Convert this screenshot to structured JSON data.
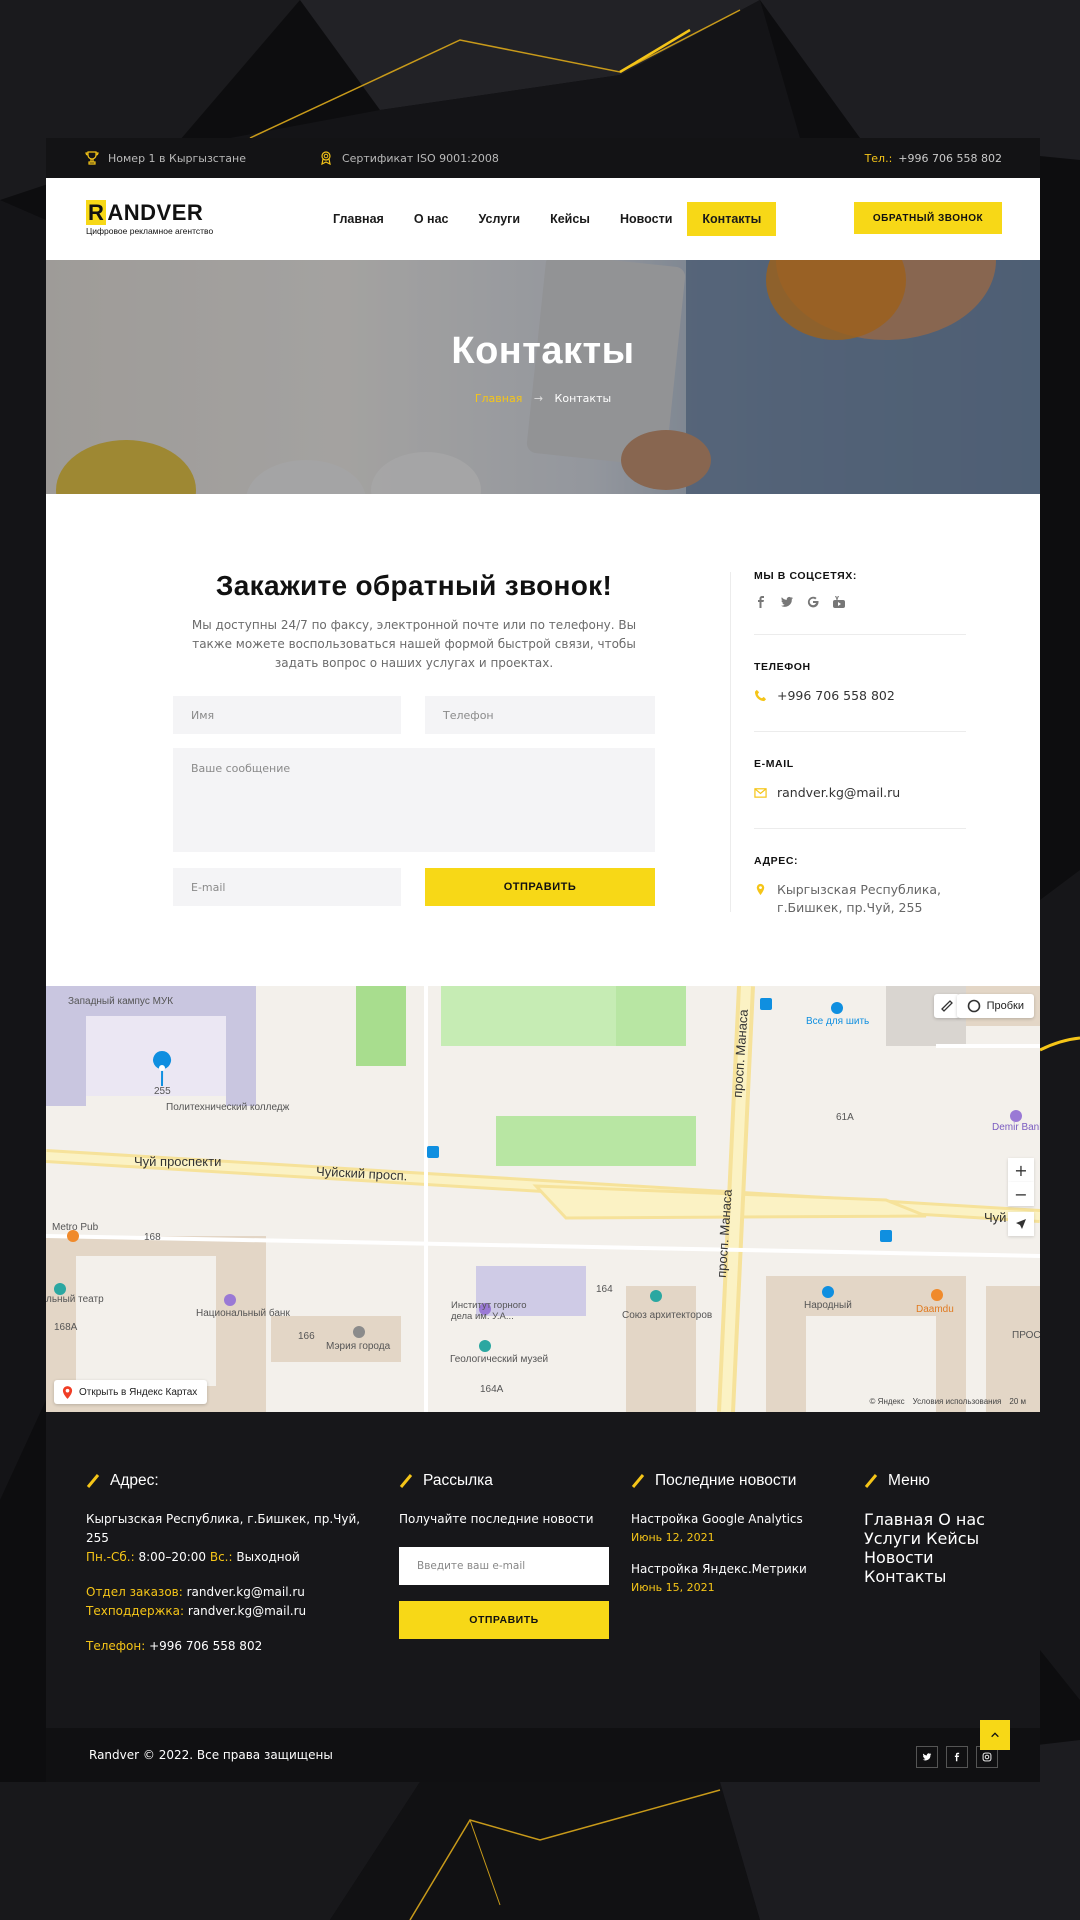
{
  "topbar": {
    "rank_text": "Номер 1 в Кыргызстане",
    "cert_text": "Сертификат ISO 9001:2008",
    "phone_label": "Тел.:",
    "phone_value": "+996 706 558 802"
  },
  "header": {
    "logo_r": "R",
    "logo_rest": "ANDVER",
    "logo_tagline": "Цифровое рекламное агентство",
    "nav": [
      "Главная",
      "О нас",
      "Услуги",
      "Кейсы",
      "Новости",
      "Контакты"
    ],
    "active_nav": "Контакты",
    "callback_button": "ОБРАТНЫЙ ЗВОНОК"
  },
  "hero": {
    "title": "Контакты",
    "crumb_home": "Главная",
    "crumb_sep": "→",
    "crumb_current": "Контакты"
  },
  "form": {
    "title": "Закажите обратный звонок!",
    "description": "Мы доступны 24/7 по факсу, электронной почте или по телефону. Вы также можете воспользоваться нашей формой быстрой связи, чтобы задать вопрос о наших услугах и проектах.",
    "name_placeholder": "Имя",
    "phone_placeholder": "Телефон",
    "message_placeholder": "Ваше сообщение",
    "email_placeholder": "E-mail",
    "submit": "ОТПРАВИТЬ"
  },
  "info": {
    "social_title": "МЫ В СОЦСЕТЯХ:",
    "social_icons": [
      "facebook-icon",
      "twitter-icon",
      "google-icon",
      "youtube-icon"
    ],
    "phone_title": "ТЕЛЕФОН",
    "phone": "+996 706 558 802",
    "email_title": "E-MAIL",
    "email": "randver.kg@mail.ru",
    "address_title": "АДРЕС:",
    "address_line1": "Кыргызская Республика,",
    "address_line2": "г.Бишкек, пр.Чуй, 255"
  },
  "map": {
    "labels": {
      "west_campus": "Западный кампус МУК",
      "address_num": "255",
      "college": "Политехнический колледж",
      "chuy_1": "Чуй проспекти",
      "chuy_2": "Чуйский просп.",
      "chuy_3": "Чуй",
      "manasa_1": "просп. Манаса",
      "manasa_2": "просп. Манаса",
      "metro_pub": "Metro Pub",
      "b168": "168",
      "teatr": "льный театр",
      "nat_bank": "Национальный банк",
      "b168a": "168А",
      "b166": "166",
      "meria": "Мэрия города",
      "institute": "Институт горного дела им. У.А...",
      "geo_museum": "Геологический музей",
      "b164": "164",
      "b164a": "164А",
      "arch_union": "Союз архитекторов",
      "narodny": "Народный",
      "daamdu": "Daamdu",
      "vse_dlya": "Все для шить",
      "b61a": "61А",
      "demir": "Demir Bank",
      "pros": "ПРОС"
    },
    "open_link": "Открыть в Яндекс Картах",
    "traffic": "Пробки",
    "zoom_in": "+",
    "zoom_out": "−",
    "copyright": "© Яндекс",
    "terms": "Условия использования",
    "scale": "20 м"
  },
  "footer": {
    "address_title": "Адрес:",
    "address": "Кыргызская Республика, г.Бишкек, пр.Чуй, 255",
    "hours_label1": "Пн.-Сб.:",
    "hours_value1": "8:00–20:00",
    "hours_label2": "Вс.:",
    "hours_value2": "Выходной",
    "orders_label": "Отдел заказов:",
    "orders_value": "randver.kg@mail.ru",
    "support_label": "Техподдержка:",
    "support_value": "randver.kg@mail.ru",
    "phone_label": "Телефон:",
    "phone_value": "+996 706 558 802",
    "newsletter_title": "Рассылка",
    "newsletter_text": "Получайте последние новости",
    "newsletter_placeholder": "Введите ваш e-mail",
    "newsletter_button": "ОТПРАВИТЬ",
    "news_title": "Последние новости",
    "news": [
      {
        "title": "Настройка Google Analytics",
        "date": "Июнь 12, 2021"
      },
      {
        "title": "Настройка Яндекс.Метрики",
        "date": "Июнь 15, 2021"
      }
    ],
    "menu_title": "Меню",
    "menu": [
      "Главная",
      "О нас",
      "Услуги",
      "Кейсы",
      "Новости",
      "Контакты"
    ],
    "copyright": "Randver © 2022. Все права защищены"
  },
  "colors": {
    "accent": "#f7d817",
    "dark": "#17171a"
  }
}
